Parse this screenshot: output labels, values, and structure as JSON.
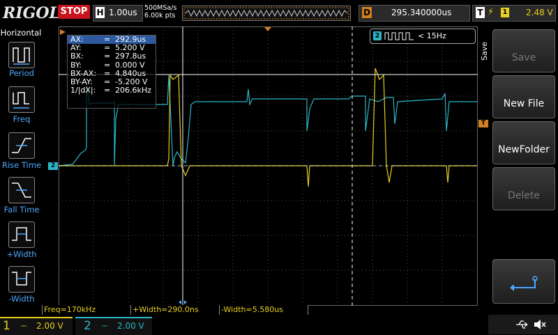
{
  "topbar": {
    "logo": "RIGOL",
    "run_state": "STOP",
    "timebase_key": "H",
    "timebase_value": "1.00us",
    "sample_rate": "500MSa/s",
    "memory_depth": "6.00k pts",
    "delay_key": "D",
    "delay_value": "295.340000us",
    "trigger_key": "T",
    "trigger_slope_icon": "rising-edge-icon",
    "trigger_source": "1",
    "trigger_level": "2.48 V"
  },
  "left_menu": {
    "title": "Horizontal",
    "items": [
      {
        "label": "Period",
        "icon": "period-icon"
      },
      {
        "label": "Freq",
        "icon": "freq-icon"
      },
      {
        "label": "Rise Time",
        "icon": "rise-time-icon"
      },
      {
        "label": "Fall Time",
        "icon": "fall-time-icon"
      },
      {
        "label": "+Width",
        "icon": "pos-width-icon"
      },
      {
        "label": "-Width",
        "icon": "neg-width-icon"
      }
    ]
  },
  "cursor_table": {
    "rows": [
      {
        "label": "AX:",
        "eq": "=",
        "value": "292.9us"
      },
      {
        "label": "AY:",
        "eq": "=",
        "value": "5.200 V"
      },
      {
        "label": "BX:",
        "eq": "=",
        "value": "297.8us"
      },
      {
        "label": "BY:",
        "eq": "=",
        "value": "0.000 V"
      },
      {
        "label": "BX-AX:",
        "eq": "=",
        "value": "4.840us"
      },
      {
        "label": "BY-AY:",
        "eq": "=",
        "value": "-5.200 V"
      },
      {
        "label": "1/|dX|:",
        "eq": "=",
        "value": "206.6kHz"
      }
    ]
  },
  "freq_counter": {
    "channel": "2",
    "value": "< 15Hz"
  },
  "markers": {
    "ch2_marker": "2",
    "trigger_marker": "T"
  },
  "right_menu": {
    "title": "Save",
    "buttons": [
      {
        "label": "Save",
        "enabled": false
      },
      {
        "label": "New File",
        "enabled": true
      },
      {
        "label": "NewFolder",
        "enabled": true
      },
      {
        "label": "Delete",
        "enabled": false
      }
    ],
    "return_icon": "return-arrow-icon"
  },
  "measurements": [
    {
      "text": "Freq=170kHz"
    },
    {
      "text": "+Width=290.0ns"
    },
    {
      "text": "-Width=5.580us"
    }
  ],
  "channels": [
    {
      "number": "1",
      "coupling_icon": "dc-coupling-icon",
      "scale": "2.00 V",
      "color": "#e8d020"
    },
    {
      "number": "2",
      "coupling_icon": "dc-coupling-icon",
      "scale": "2.00 V",
      "color": "#2ab8c8"
    }
  ],
  "status_icons": [
    "usb-icon",
    "speaker-mute-icon"
  ],
  "colors": {
    "ch1": "#e8d020",
    "ch2": "#2ab8c8",
    "menu_accent": "#4fa8ff",
    "stop_red": "#c8141e",
    "trigger_orange": "#d08020"
  }
}
